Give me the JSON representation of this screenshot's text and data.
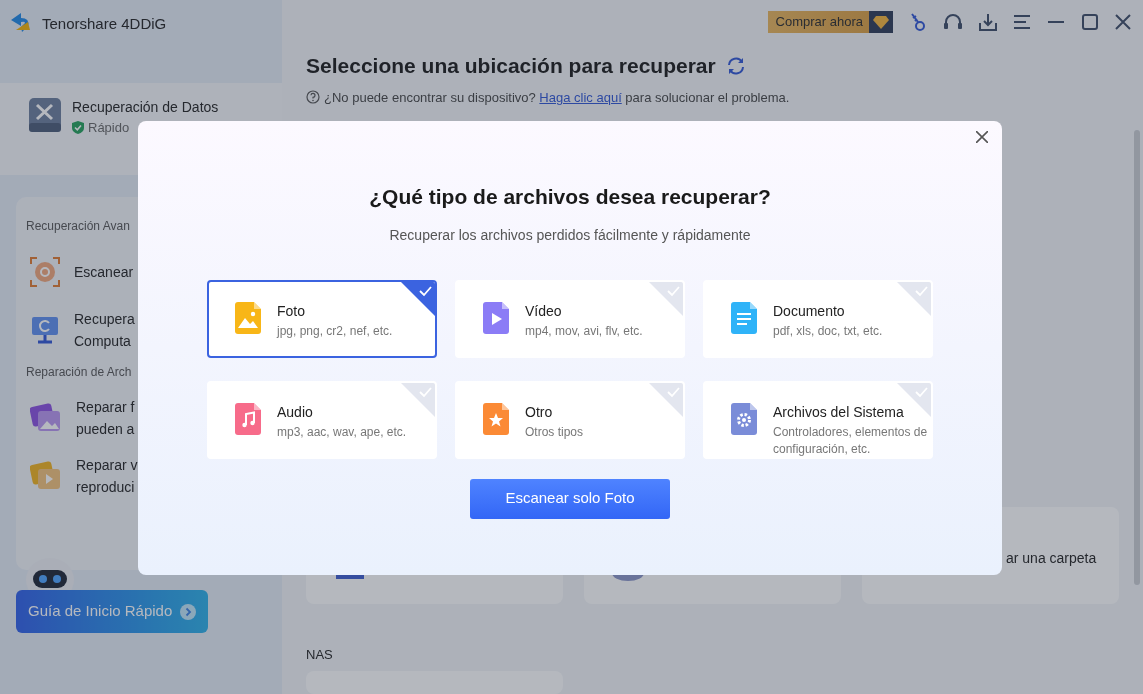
{
  "app": {
    "title": "Tenorshare 4DDiG"
  },
  "toolbar": {
    "buy_button": "Comprar ahora"
  },
  "sidebar": {
    "main_item": {
      "title": "Recuperación de Datos",
      "subtitle": "Rápido"
    },
    "sections": [
      {
        "heading": "Recuperación Avan",
        "items": [
          {
            "kind": "scan",
            "lines": [
              "Escanear"
            ]
          },
          {
            "kind": "computer",
            "lines": [
              "Recupera",
              "Computa"
            ]
          }
        ]
      },
      {
        "heading": "Reparación de Arch",
        "items": [
          {
            "kind": "photo",
            "lines": [
              "Reparar f",
              "pueden a"
            ]
          },
          {
            "kind": "video",
            "lines": [
              "Reparar v",
              "reproduci"
            ]
          }
        ]
      }
    ],
    "guide_button": "Guía de Inicio Rápido"
  },
  "main": {
    "heading": "Seleccione una ubicación para recuperar",
    "help": {
      "before": "¿No puede encontrar su dispositivo?",
      "link": "Haga clic aquí",
      "after": "para solucionar el problema."
    },
    "location_cards": [
      {
        "kind": "drive"
      },
      {
        "kind": "disk"
      },
      {
        "kind": "folder",
        "label": "ar una carpeta"
      }
    ],
    "nas_heading": "NAS"
  },
  "dialog": {
    "title": "¿Qué tipo de archivos desea recuperar?",
    "subtitle": "Recuperar los archivos perdidos fácilmente y rápidamente",
    "options": [
      {
        "kind": "photo",
        "label": "Foto",
        "description": "jpg, png, cr2, nef, etc.",
        "selected": true
      },
      {
        "kind": "video",
        "label": "Vídeo",
        "description": "mp4, mov, avi, flv, etc.",
        "selected": false
      },
      {
        "kind": "document",
        "label": "Documento",
        "description": "pdf, xls, doc, txt, etc.",
        "selected": false
      },
      {
        "kind": "audio",
        "label": "Audio",
        "description": "mp3, aac, wav, ape, etc.",
        "selected": false
      },
      {
        "kind": "other",
        "label": "Otro",
        "description": "Otros tipos",
        "selected": false
      },
      {
        "kind": "system",
        "label": "Archivos del Sistema",
        "description": "Controladores, elementos de configuración, etc.",
        "selected": false
      }
    ],
    "scan_button": "Escanear solo Foto"
  }
}
